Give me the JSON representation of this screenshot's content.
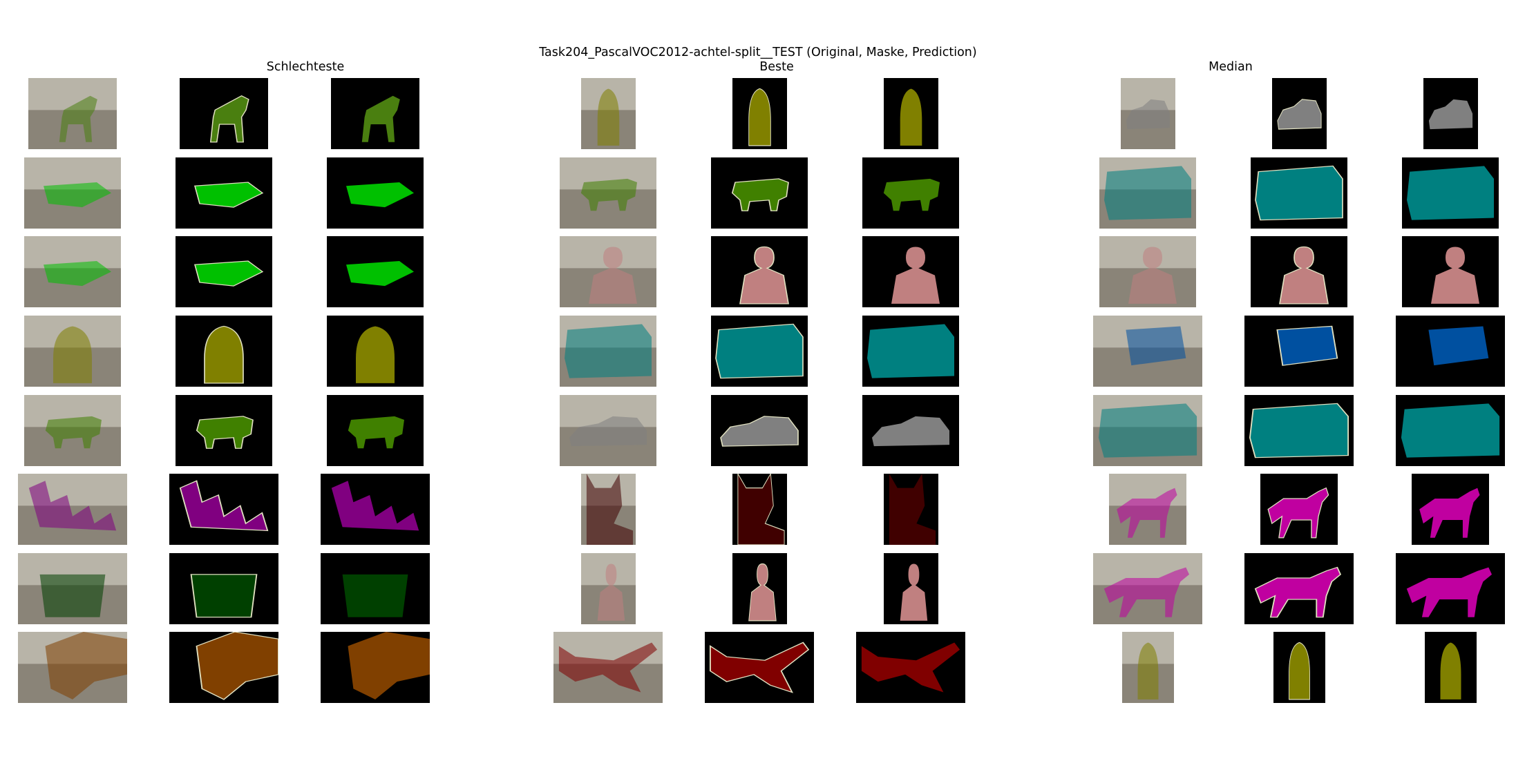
{
  "figure": {
    "title": "Task204_PascalVOC2012-achtel-split__TEST (Original, Maske, Prediction)",
    "groups": [
      {
        "title": "Schlechteste"
      },
      {
        "title": "Beste"
      },
      {
        "title": "Median"
      }
    ]
  },
  "colors": {
    "background": "#000000",
    "boundary": "#e0e0c0",
    "dog": "#4a7f10",
    "person": "#c08080",
    "bird": "#808000",
    "cow": "#408000",
    "bus": "#008080",
    "car": "#808080",
    "pottedplant": "#004000",
    "train": "#0050a0",
    "horse": "#c000a0",
    "bottle": "#800080",
    "sheep": "#804000",
    "aeroplane": "#800000",
    "cat": "#400000",
    "bicycle": "#00c000",
    "sofa": "#00c000"
  },
  "rows": [
    {
      "schlechteste": "dog",
      "beste": "bird",
      "median": "car"
    },
    {
      "schlechteste": "sofa",
      "beste": "cow",
      "median": "bus"
    },
    {
      "schlechteste": "sofa",
      "beste": "person",
      "median": "person"
    },
    {
      "schlechteste": "bird",
      "beste": "bus",
      "median": "train"
    },
    {
      "schlechteste": "cow",
      "beste": "car",
      "median": "bus"
    },
    {
      "schlechteste": "bottle",
      "beste": "cat",
      "median": "horse"
    },
    {
      "schlechteste": "pottedplant",
      "beste": "person",
      "median": "horse"
    },
    {
      "schlechteste": "sheep",
      "beste": "aeroplane",
      "median": "bird"
    }
  ]
}
